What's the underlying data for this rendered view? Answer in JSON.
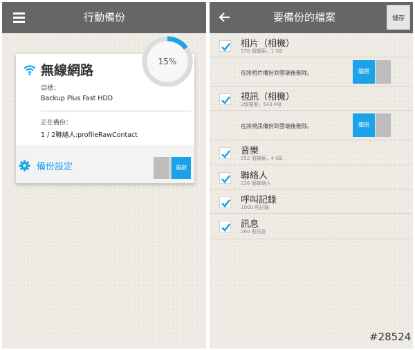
{
  "left": {
    "title": "行動備份",
    "progress_percent": 15,
    "progress_label": "15%",
    "card": {
      "network_title": "無線網路",
      "target_label": "目標：",
      "target_value": "Backup Plus Fast HDD",
      "backing_up_label": "正在備份：",
      "backing_up_value": "1 / 2聯絡人:profileRawContact",
      "settings_label": "備份設定",
      "toggle_label": "開啟"
    }
  },
  "right": {
    "title": "要備份的檔案",
    "save_label": "儲存",
    "items": [
      {
        "title": "相片（相機）",
        "sub": "576 個檔案，1 GB",
        "checked": true
      },
      {
        "title": "視訊（相機）",
        "sub": "2個檔案，543 MB",
        "checked": true
      },
      {
        "title": "音樂",
        "sub": "552 個檔案，4 GB",
        "checked": true
      },
      {
        "title": "聯絡人",
        "sub": "226 個聯絡人",
        "checked": true
      },
      {
        "title": "呼叫記錄",
        "sub": "1000 則記錄",
        "checked": true
      },
      {
        "title": "訊息",
        "sub": "260 則訊息",
        "checked": true
      }
    ],
    "sub_options": [
      {
        "text": "在將相片備份到雲端後刪除。",
        "toggle_label": "關閉"
      },
      {
        "text": "在將視訊備份到雲端後刪除。",
        "toggle_label": "關閉"
      }
    ]
  },
  "watermark": "#28524",
  "colors": {
    "accent": "#1aa3e8",
    "appbar": "#666666",
    "background": "#edebe3",
    "toggle_off": "#cfcfcf"
  },
  "icons": [
    "hamburger-menu-icon",
    "wifi-icon",
    "gear-icon",
    "back-arrow-icon",
    "checkmark-icon"
  ]
}
